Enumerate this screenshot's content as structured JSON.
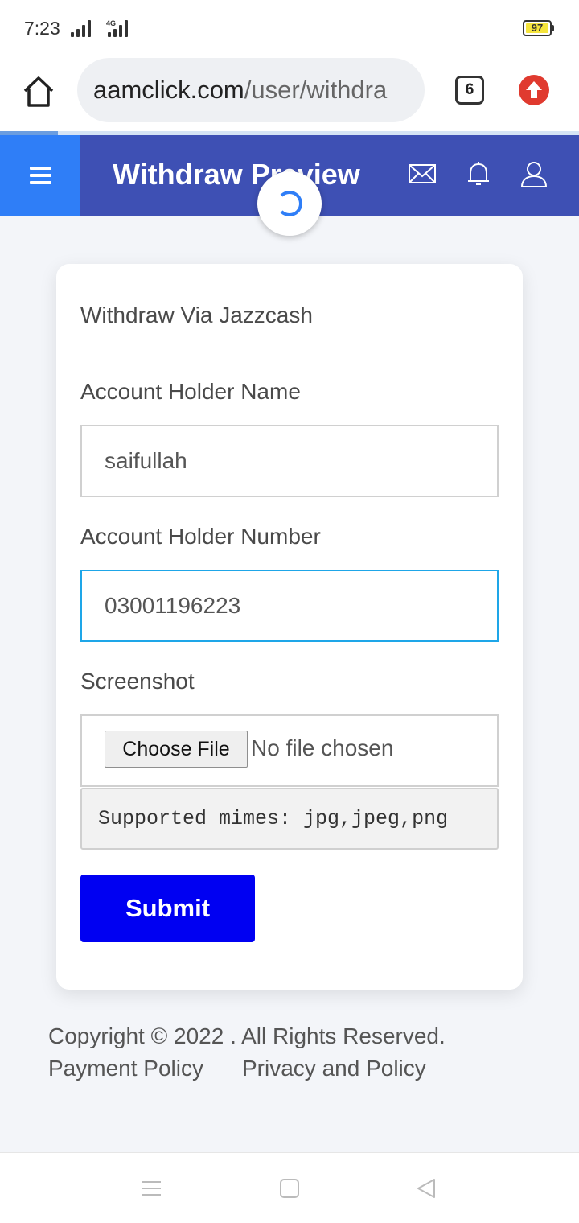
{
  "status_bar": {
    "time": "7:23",
    "network": "4G",
    "battery": "97"
  },
  "browser": {
    "url_domain": "aamclick.com",
    "url_path": "/user/withdra",
    "tab_count": "6"
  },
  "header": {
    "title": "Withdraw Preview"
  },
  "form": {
    "title": "Withdraw Via Jazzcash",
    "name_label": "Account Holder Name",
    "name_value": "saifullah",
    "number_label": "Account Holder Number",
    "number_value": "03001196223",
    "screenshot_label": "Screenshot",
    "choose_file_label": "Choose File",
    "no_file_text": "No file chosen",
    "mimes_text": "Supported mimes: jpg,jpeg,png",
    "submit_label": "Submit"
  },
  "footer": {
    "copyright": "Copyright © 2022 . All Rights Reserved.",
    "payment_policy": "Payment Policy",
    "privacy_policy": "Privacy and Policy"
  },
  "colors": {
    "header_bg": "#3e50b4",
    "menu_bg": "#2f7ef7",
    "submit_bg": "#0000f2",
    "focus_border": "#1ea6e8"
  }
}
